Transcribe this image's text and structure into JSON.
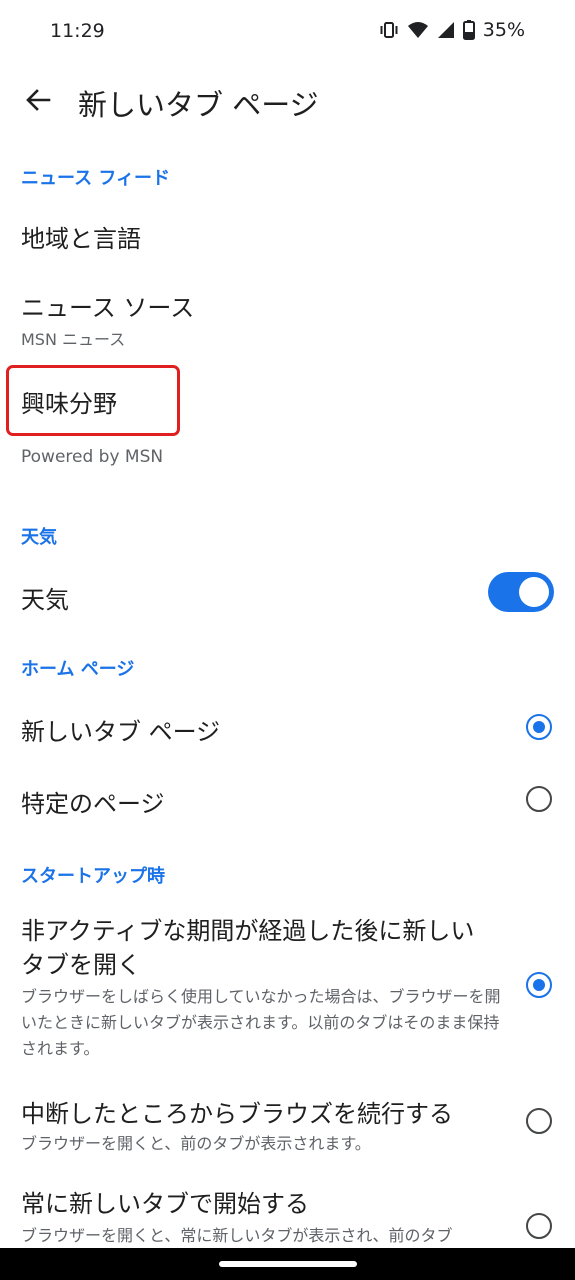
{
  "status": {
    "time": "11:29",
    "battery": "35%",
    "icons": [
      "vibrate-icon",
      "wifi-icon",
      "signal-icon",
      "battery-icon"
    ]
  },
  "app_bar": {
    "title": "新しいタブ ページ",
    "back_icon": "arrow-left-icon"
  },
  "news_feed": {
    "header": "ニュース フィード",
    "region_language": "地域と言語",
    "news_source": "ニュース ソース",
    "news_source_value": "MSN ニュース",
    "interests": "興味分野",
    "powered_by": "Powered by MSN"
  },
  "weather": {
    "header": "天気",
    "toggle_label": "天気",
    "enabled": true
  },
  "home_page": {
    "header": "ホーム ページ",
    "options": [
      {
        "label": "新しいタブ ページ",
        "selected": true
      },
      {
        "label": "特定のページ",
        "selected": false
      }
    ]
  },
  "startup": {
    "header": "スタートアップ時",
    "options": [
      {
        "title": "非アクティブな期間が経過した後に新しいタブを開く",
        "description": "ブラウザーをしばらく使用していなかった場合は、ブラウザーを開いたときに新しいタブが表示されます。以前のタブはそのまま保持されます。",
        "selected": true
      },
      {
        "title": "中断したところからブラウズを続行する",
        "description": "ブラウザーを開くと、前のタブが表示されます。",
        "selected": false
      },
      {
        "title": "常に新しいタブで開始する",
        "description": "ブラウザーを開くと、常に新しいタブが表示され、前のタブ",
        "selected": false
      }
    ]
  },
  "colors": {
    "accent": "#1a73e8",
    "highlight": "#e02020"
  }
}
